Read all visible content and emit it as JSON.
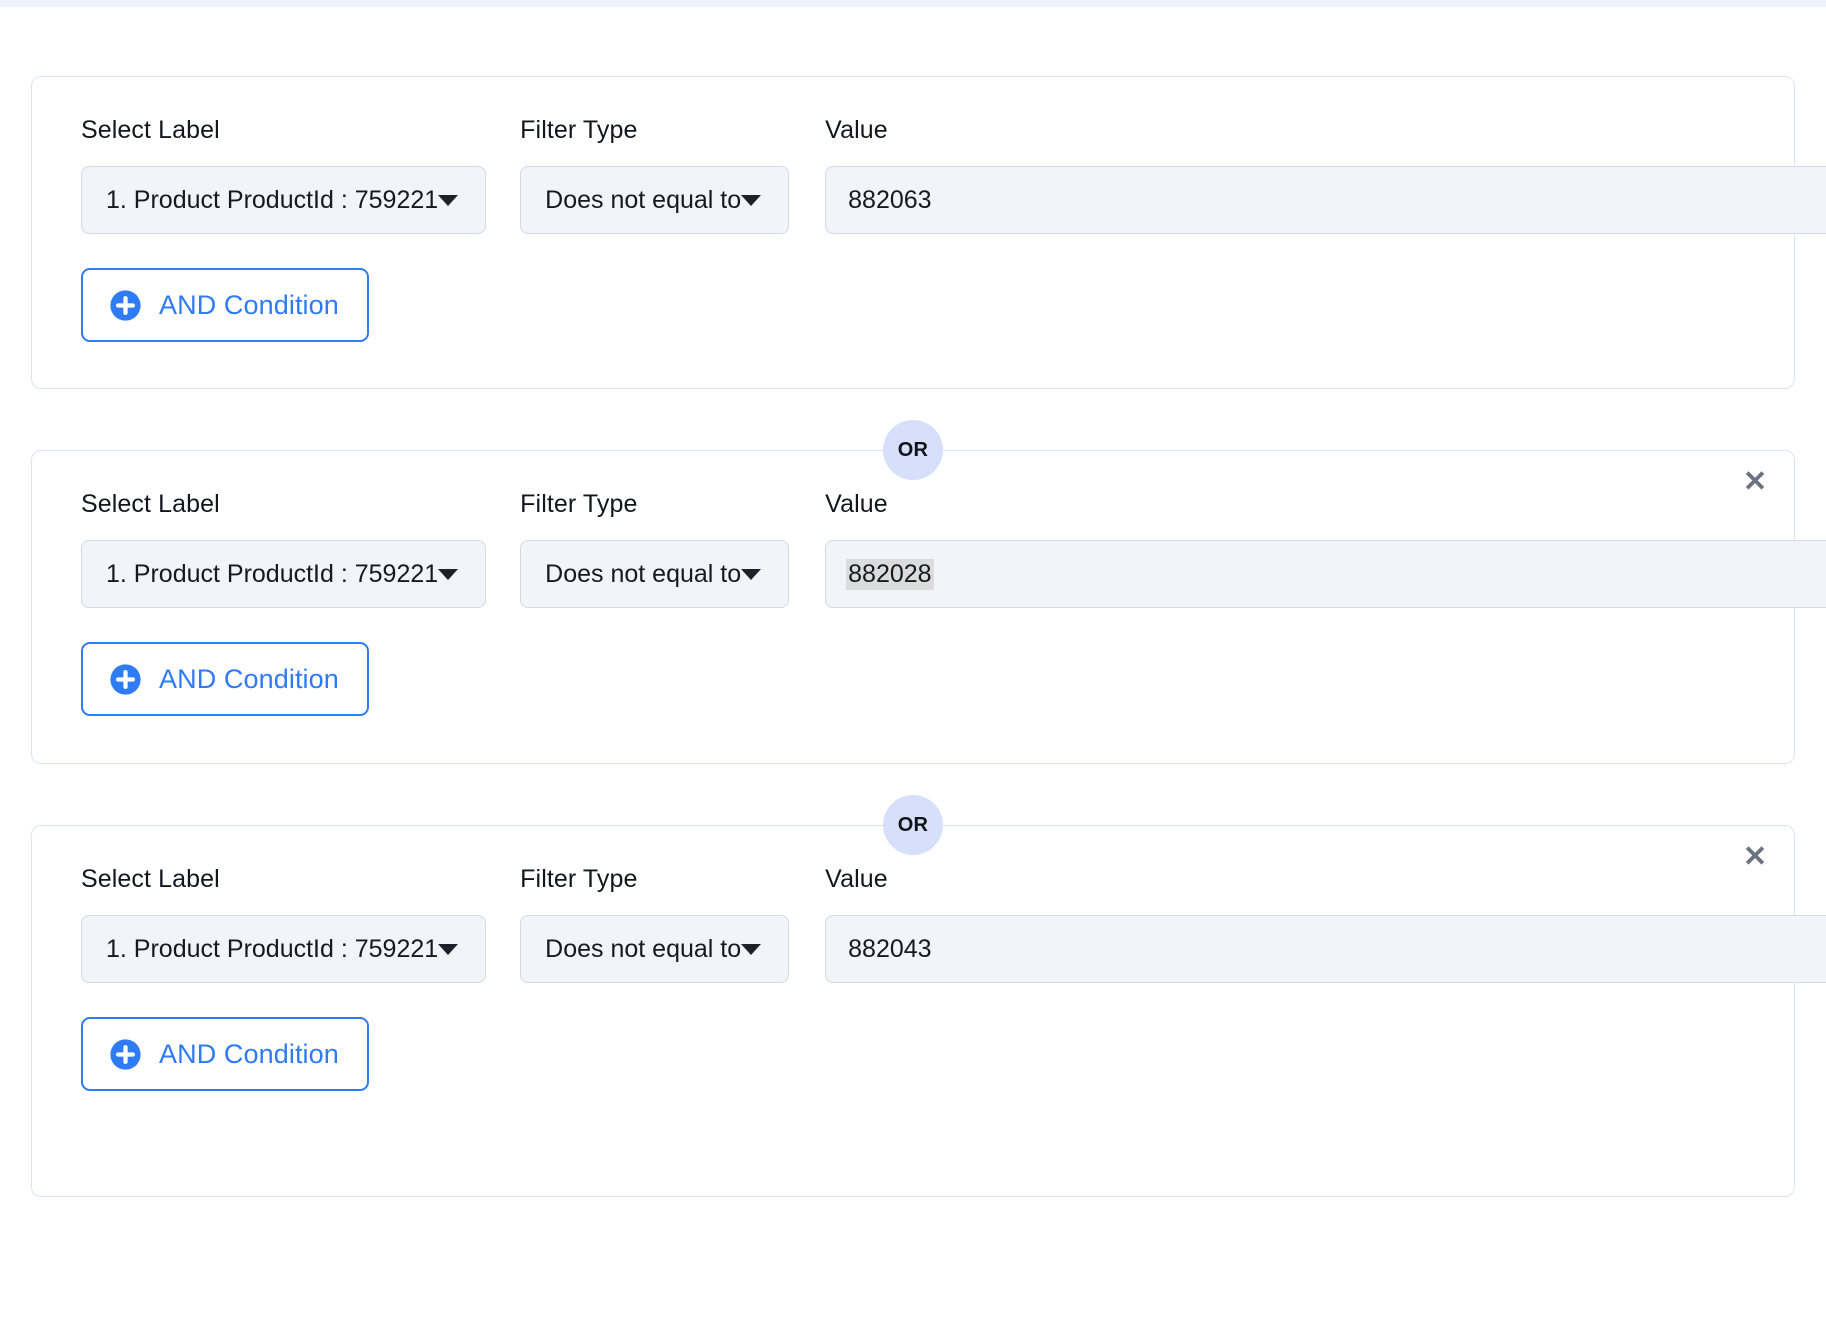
{
  "colors": {
    "accent_blue": "#2f7bf6",
    "confirm_blue": "#4a9bf5",
    "or_badge_bg": "#d6e0fb",
    "card_border": "#dbe4f6",
    "field_bg": "#f1f5f9",
    "field_border": "#d4dae2",
    "selection_highlight": "#dcdcdc",
    "close_icon": "#6b7280"
  },
  "labels": {
    "select_label": "Select Label",
    "filter_type": "Filter Type",
    "value": "Value"
  },
  "separator": {
    "or_text": "OR"
  },
  "icons": {
    "close": "✕",
    "caret_down": "caret-down-icon",
    "plus_circle": "plus-circle-icon",
    "check_circle": "check-circle-icon"
  },
  "groups": [
    {
      "select_label_value": "1. Product ProductId : 759221",
      "filter_type_value": "Does not equal to",
      "value_value": "882063",
      "value_selected": false,
      "has_confirm_button": true,
      "has_close_button": false,
      "and_condition_label": "AND Condition"
    },
    {
      "select_label_value": "1. Product ProductId : 759221",
      "filter_type_value": "Does not equal to",
      "value_value": "882028",
      "value_selected": true,
      "has_confirm_button": true,
      "has_close_button": true,
      "and_condition_label": "AND Condition"
    },
    {
      "select_label_value": "1. Product ProductId : 759221",
      "filter_type_value": "Does not equal to",
      "value_value": "882043",
      "value_selected": false,
      "has_confirm_button": false,
      "has_close_button": true,
      "and_condition_label": "AND Condition"
    }
  ]
}
